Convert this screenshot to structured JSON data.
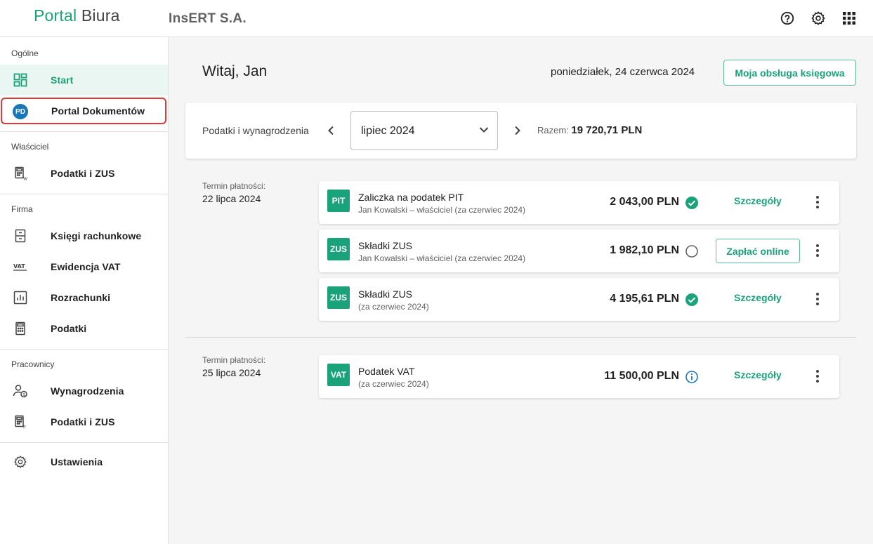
{
  "header": {
    "logo_part1": "Portal",
    "logo_part2": "Biura",
    "company": "InsERT S.A.",
    "icons": [
      "help-icon",
      "gear-icon",
      "apps-grid-icon"
    ]
  },
  "sidebar": {
    "sections": {
      "general": "Ogólne",
      "owner": "Właściciel",
      "company": "Firma",
      "employees": "Pracownicy"
    },
    "items": {
      "start": "Start",
      "documents_badge": "PD",
      "documents": "Portal Dokumentów",
      "owner_taxes": "Podatki i ZUS",
      "books": "Księgi rachunkowe",
      "vat": "Ewidencja VAT",
      "settlements": "Rozrachunki",
      "taxes": "Podatki",
      "salaries": "Wynagrodzenia",
      "employee_taxes": "Podatki i ZUS",
      "settings": "Ustawienia"
    }
  },
  "main": {
    "greeting": "Witaj, Jan",
    "date": "poniedziałek, 24 czerwca 2024",
    "accounting_button": "Moja obsługa księgowa",
    "filter": {
      "label": "Podatki i wynagrodzenia",
      "month": "lipiec 2024",
      "total_label": "Razem:",
      "total_value": "19 720,71 PLN"
    },
    "groups": [
      {
        "term_label": "Termin płatności:",
        "term_date": "22 lipca 2024",
        "payments": [
          {
            "tag": "PIT",
            "title": "Zaliczka na podatek PIT",
            "subtitle": "Jan Kowalski – właściciel (za czerwiec 2024)",
            "amount": "2 043,00 PLN",
            "status": "paid",
            "action": "Szczegóły"
          },
          {
            "tag": "ZUS",
            "title": "Składki ZUS",
            "subtitle": "Jan Kowalski – właściciel (za czerwiec 2024)",
            "amount": "1 982,10 PLN",
            "status": "unpaid",
            "action": "Zapłać online"
          },
          {
            "tag": "ZUS",
            "title": "Składki ZUS",
            "subtitle": "(za czerwiec 2024)",
            "amount": "4 195,61 PLN",
            "status": "paid",
            "action": "Szczegóły"
          }
        ]
      },
      {
        "term_label": "Termin płatności:",
        "term_date": "25 lipca 2024",
        "payments": [
          {
            "tag": "VAT",
            "title": "Podatek VAT",
            "subtitle": "(za czerwiec 2024)",
            "amount": "11 500,00 PLN",
            "status": "info",
            "action": "Szczegóły"
          }
        ]
      }
    ],
    "colors": {
      "accent": "#1aa37a",
      "info": "#1976b8",
      "highlight": "#e53935"
    }
  }
}
